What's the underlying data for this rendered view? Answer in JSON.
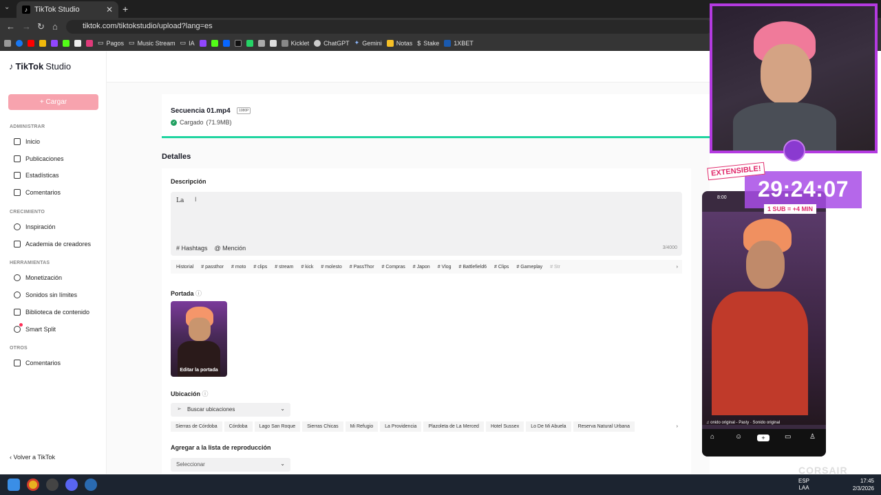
{
  "browser": {
    "tab_title": "TikTok Studio",
    "tab_close": "✕",
    "new_tab": "+",
    "url": "tiktok.com/tiktokstudio/upload?lang=es",
    "bookmarks": [
      "Pagos",
      "Music Stream",
      "IA",
      "Kicklet",
      "ChatGPT",
      "Gemini",
      "Notas",
      "Stake",
      "1XBET"
    ]
  },
  "sidebar": {
    "logo_brand": "TikTok",
    "logo_product": "Studio",
    "upload_label": "+ Cargar",
    "sections": {
      "admin": "ADMINISTRAR",
      "growth": "CRECIMIENTO",
      "tools": "HERRAMIENTAS",
      "others": "OTROS"
    },
    "items": {
      "home": "Inicio",
      "posts": "Publicaciones",
      "stats": "Estadísticas",
      "comments": "Comentarios",
      "inspiration": "Inspiración",
      "academy": "Academia de creadores",
      "monetization": "Monetización",
      "sounds": "Sonidos sin límites",
      "library": "Biblioteca de contenido",
      "smartsplit": "Smart Split",
      "comments2": "Comentarios"
    },
    "back_label": "Volver a TikTok"
  },
  "upload": {
    "filename": "Secuencia 01.mp4",
    "resolution": "1080P",
    "status": "Cargado",
    "size": "(71.9MB)"
  },
  "details": {
    "title": "Detalles",
    "description_label": "Descripción",
    "description_value": "La",
    "hashtags_label": "# Hashtags",
    "mention_label": "@ Mención",
    "counter": "3/4000",
    "tags": [
      "Historial",
      "# passthor",
      "# moto",
      "# clips",
      "# stream",
      "# kick",
      "# molesto",
      "# PassThor",
      "# Compras",
      "# Japon",
      "# Vlog",
      "# Battlefield6",
      "# Clips",
      "# Gameplay",
      "# Str"
    ],
    "cover_label": "Portada",
    "cover_edit": "Editar la portada",
    "location_label": "Ubicación",
    "location_placeholder": "Buscar ubicaciones",
    "locations": [
      "Sierras de Córdoba",
      "Córdoba",
      "Lago San Roque",
      "Sierras Chicas",
      "Mi Refugio",
      "La Providencia",
      "Plazoleta de La Merced",
      "Hotel Sussex",
      "Lo De Mi Abuela",
      "Reserva Natural Urbana"
    ],
    "playlist_label": "Agregar a la lista de reproducción",
    "playlist_placeholder": "Seleccionar"
  },
  "stream": {
    "extensible": "EXTENSIBLE!",
    "timer": "29:24:07",
    "sub_rule": "1 SUB = +4 MIN",
    "phone_time": "8:00",
    "phone_sound": "♫ onido original - Pasty · Sonido original",
    "corsair": "CORSAIR"
  },
  "taskbar": {
    "lang_1": "ESP",
    "lang_2": "LAA",
    "time": "17:45",
    "date": "2/3/2026"
  },
  "colors": {
    "accent": "#fe2c55",
    "upload_btn": "#f7a3ae",
    "progress": "#20d5a0",
    "stream_purple": "#a84ce6"
  }
}
